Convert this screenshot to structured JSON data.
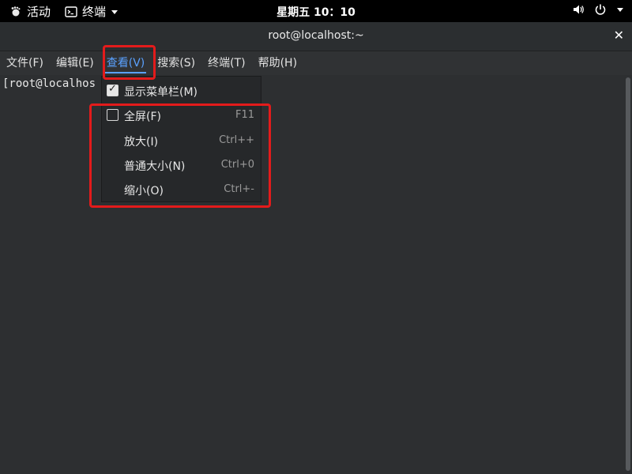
{
  "topbar": {
    "activities": "活动",
    "app_menu": "终端",
    "clock": "星期五 10：10"
  },
  "window": {
    "title": "root@localhost:~"
  },
  "menubar": {
    "items": [
      {
        "label": "文件(F)"
      },
      {
        "label": "编辑(E)"
      },
      {
        "label": "查看(V)",
        "active": true
      },
      {
        "label": "搜索(S)"
      },
      {
        "label": "终端(T)"
      },
      {
        "label": "帮助(H)"
      }
    ]
  },
  "terminal": {
    "prompt": "[root@localhos"
  },
  "view_menu": {
    "items": [
      {
        "label": "显示菜单栏(M)",
        "checkbox": true,
        "checked": true,
        "accel": ""
      },
      {
        "label": "全屏(F)",
        "checkbox": true,
        "checked": false,
        "accel": "F11"
      },
      {
        "label": "放大(I)",
        "checkbox": false,
        "accel": "Ctrl++"
      },
      {
        "label": "普通大小(N)",
        "checkbox": false,
        "accel": "Ctrl+0"
      },
      {
        "label": "缩小(O)",
        "checkbox": false,
        "accel": "Ctrl+-"
      }
    ]
  },
  "colors": {
    "accent": "#5aa1ff",
    "highlight": "#e31b1b"
  }
}
